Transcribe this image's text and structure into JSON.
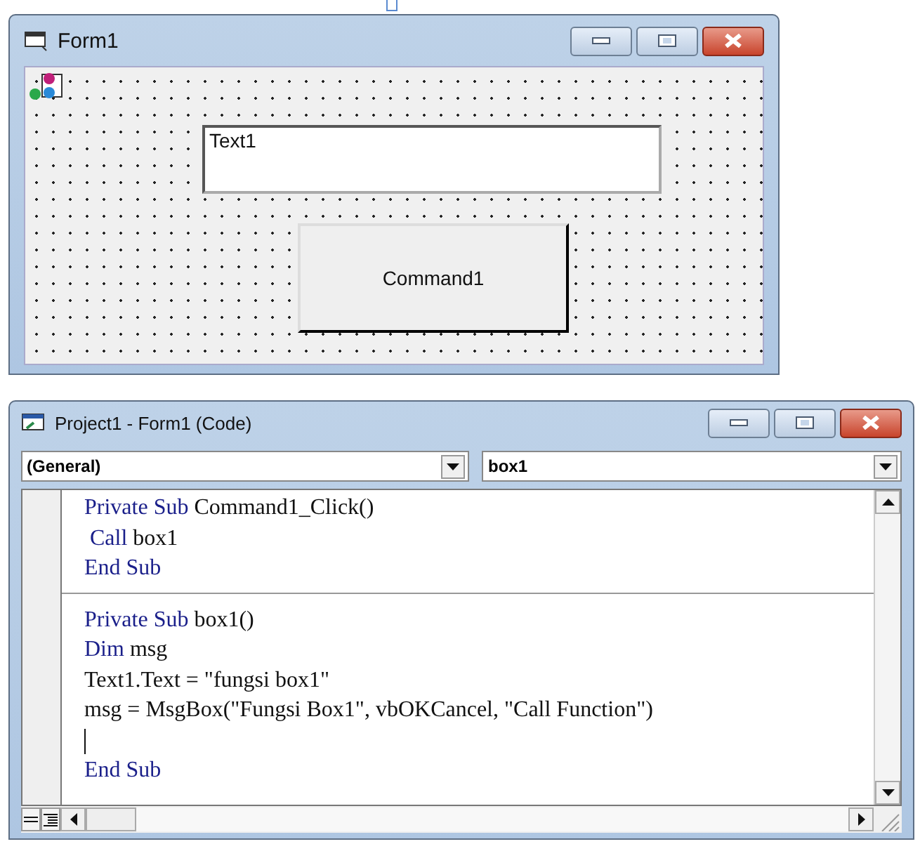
{
  "form_window": {
    "title": "Form1",
    "textbox": {
      "value": "Text1"
    },
    "button": {
      "label": "Command1"
    }
  },
  "code_window": {
    "title": "Project1 - Form1 (Code)",
    "object_combo": {
      "value": "(General)"
    },
    "procedure_combo": {
      "value": "box1"
    },
    "procedures": [
      {
        "lines": [
          {
            "caret": false,
            "segments": [
              {
                "kind": "keyword",
                "text": "Private Sub"
              },
              {
                "kind": "plain",
                "text": " Command1_Click()"
              }
            ]
          },
          {
            "caret": false,
            "segments": [
              {
                "kind": "keyword",
                "text": " Call"
              },
              {
                "kind": "plain",
                "text": " box1"
              }
            ]
          },
          {
            "caret": false,
            "segments": [
              {
                "kind": "keyword",
                "text": "End Sub"
              }
            ]
          }
        ]
      },
      {
        "lines": [
          {
            "caret": false,
            "segments": [
              {
                "kind": "keyword",
                "text": "Private Sub"
              },
              {
                "kind": "plain",
                "text": " box1()"
              }
            ]
          },
          {
            "caret": false,
            "segments": [
              {
                "kind": "keyword",
                "text": "Dim"
              },
              {
                "kind": "plain",
                "text": " msg"
              }
            ]
          },
          {
            "caret": false,
            "segments": [
              {
                "kind": "plain",
                "text": "Text1.Text = \"fungsi box1\""
              }
            ]
          },
          {
            "caret": false,
            "segments": [
              {
                "kind": "plain",
                "text": "msg = MsgBox(\"Fungsi Box1\", vbOKCancel, \"Call Function\")"
              }
            ]
          },
          {
            "caret": true
          },
          {
            "caret": false,
            "segments": [
              {
                "kind": "keyword",
                "text": "End Sub"
              }
            ]
          }
        ]
      }
    ]
  }
}
